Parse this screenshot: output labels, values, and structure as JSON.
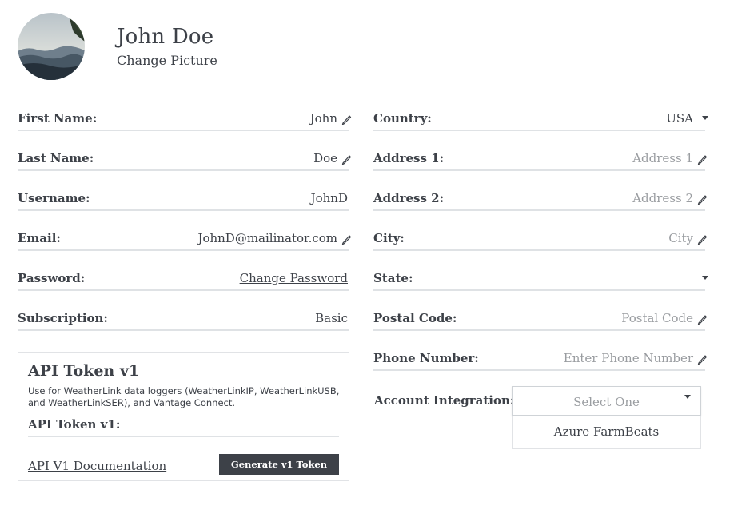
{
  "profile": {
    "name": "John Doe",
    "change_picture": "Change Picture"
  },
  "left_fields": [
    {
      "label": "First Name:",
      "value": "John",
      "kind": "text",
      "icon": "pencil-icon"
    },
    {
      "label": "Last Name:",
      "value": "Doe",
      "kind": "text",
      "icon": "pencil-icon"
    },
    {
      "label": "Username:",
      "value": "JohnD",
      "kind": "text",
      "icon": ""
    },
    {
      "label": "Email:",
      "value": "JohnD@mailinator.com",
      "kind": "text",
      "icon": "pencil-icon"
    },
    {
      "label": "Password:",
      "value": "Change Password",
      "kind": "link",
      "icon": ""
    },
    {
      "label": "Subscription:",
      "value": "Basic",
      "kind": "text",
      "icon": ""
    }
  ],
  "right_fields": [
    {
      "label": "Country:",
      "value": "USA",
      "kind": "select",
      "icon": "caret-down-icon"
    },
    {
      "label": "Address 1:",
      "placeholder": "Address 1",
      "kind": "placeholder",
      "icon": "pencil-icon"
    },
    {
      "label": "Address 2:",
      "placeholder": "Address 2",
      "kind": "placeholder",
      "icon": "pencil-icon"
    },
    {
      "label": "City:",
      "placeholder": "City",
      "kind": "placeholder",
      "icon": "pencil-icon"
    },
    {
      "label": "State:",
      "value": "",
      "kind": "select",
      "icon": "caret-down-icon"
    },
    {
      "label": "Postal Code:",
      "placeholder": "Postal Code",
      "kind": "placeholder",
      "icon": "pencil-icon"
    },
    {
      "label": "Phone Number:",
      "placeholder": "Enter Phone Number",
      "kind": "placeholder",
      "icon": "pencil-icon"
    }
  ],
  "api_token": {
    "title": "API Token v1",
    "description": "Use for WeatherLink data loggers (WeatherLinkIP, WeatherLinkUSB, and WeatherLinkSER), and Vantage Connect.",
    "field_label": "API Token v1:",
    "doc_link": "API V1 Documentation",
    "generate_button": "Generate v1 Token"
  },
  "integration": {
    "label": "Account Integration:",
    "select_placeholder": "Select One",
    "options": [
      "Azure FarmBeats"
    ]
  },
  "colors": {
    "text": "#3d4148",
    "placeholder": "#9a9da1",
    "underline": "#dfe2e5",
    "button_bg": "#3d4148"
  }
}
